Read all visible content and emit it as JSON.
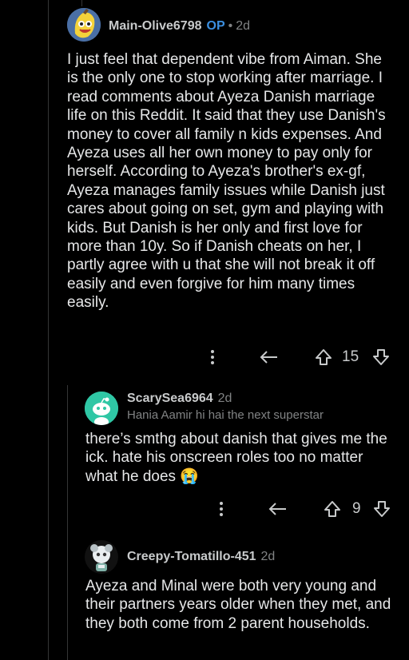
{
  "comments": [
    {
      "username": "Main-Olive6798",
      "op_badge": "OP",
      "time": "2d",
      "body": "I just feel that dependent vibe from Aiman. She is the only one to stop working after marriage. I read comments about Ayeza Danish marriage life on this Reddit. It said that they use Danish's money to cover all family n kids expenses. And Ayeza uses all her own money to pay only for herself. According to Ayeza's brother's ex-gf, Ayeza manages family issues while Danish just cares about going on set, gym and playing with kids. But Danish is her only and first love for more than 10y. So if Danish cheats on her, I partly agree with u that she will not break it off easily and even forgive for him many times easily.",
      "votes": "15"
    },
    {
      "username": "ScarySea6964",
      "time": "2d",
      "flair": "Hania Aamir hi hai the next superstar",
      "body": "there’s smthg about danish that gives me the ick. hate his onscreen roles too no matter what he does 😭",
      "votes": "9"
    },
    {
      "username": "Creepy-Tomatillo-451",
      "time": "2d",
      "body": "Ayeza and Minal were both very young and their partners years older when they met, and they both come from 2 parent households."
    }
  ],
  "icons": {
    "more": "more-vertical-icon",
    "reply": "reply-arrow-icon",
    "upvote": "upvote-arrow-icon",
    "downvote": "downvote-arrow-icon"
  },
  "colors": {
    "background": "#000000",
    "op": "#3b8fe0",
    "avatar1_bg": "#4a6fa5",
    "avatar2_bg": "#2fc7a5"
  }
}
